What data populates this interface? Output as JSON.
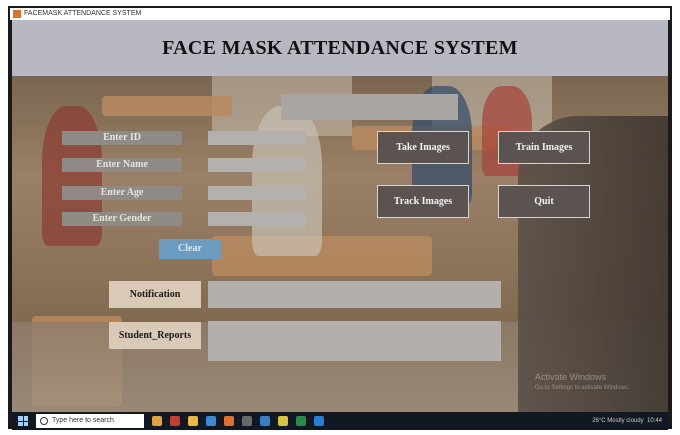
{
  "window": {
    "title": "FACEMASK ATTENDANCE SYSTEM"
  },
  "header": {
    "title": "FACE MASK ATTENDANCE SYSTEM"
  },
  "form": {
    "fields": [
      {
        "label": "Enter ID",
        "value": ""
      },
      {
        "label": "Enter Name",
        "value": ""
      },
      {
        "label": "Enter Age",
        "value": ""
      },
      {
        "label": "Enter Gender",
        "value": ""
      }
    ],
    "clear_label": "Clear"
  },
  "actions": {
    "take_images": "Take Images",
    "train_images": "Train Images",
    "track_images": "Track Images",
    "quit": "Quit"
  },
  "output": {
    "notification_label": "Notification",
    "notification_value": "",
    "reports_label": "Student_Reports",
    "reports_value": ""
  },
  "taskbar": {
    "search_placeholder": "Type here to search",
    "tray_text": "26°C Mostly cloudy",
    "time": "10:44"
  },
  "watermark": {
    "line1": "Activate Windows",
    "line2": "Go to Settings to activate Windows."
  },
  "colors": {
    "header_bg": "#b8b8c2",
    "button_bg": "#5b5350",
    "clear_bg": "#6b9cc0",
    "label_bg": "#8f8a86"
  }
}
